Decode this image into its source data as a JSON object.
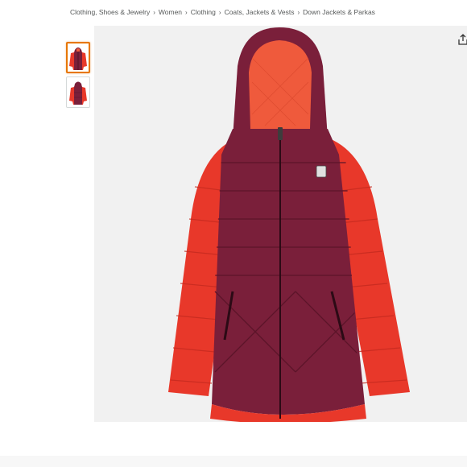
{
  "breadcrumb": [
    {
      "label": "Clothing, Shoes & Jewelry"
    },
    {
      "label": "Women"
    },
    {
      "label": "Clothing"
    },
    {
      "label": "Coats, Jackets & Vests"
    },
    {
      "label": "Down Jackets & Parkas"
    }
  ],
  "breadcrumb_separator": "›",
  "thumbnails": [
    {
      "icon": "jacket-front-thumbnail",
      "selected": true
    },
    {
      "icon": "jacket-back-thumbnail",
      "selected": false
    }
  ],
  "main_image": {
    "icon": "hooded-puffer-jacket-image"
  },
  "share": {
    "icon": "share-icon"
  },
  "colors": {
    "jacket_body": "#7a1f3a",
    "jacket_sleeve": "#e8382a",
    "hood_lining": "#ef5a3c",
    "thumb_selected_border": "#e77600"
  }
}
